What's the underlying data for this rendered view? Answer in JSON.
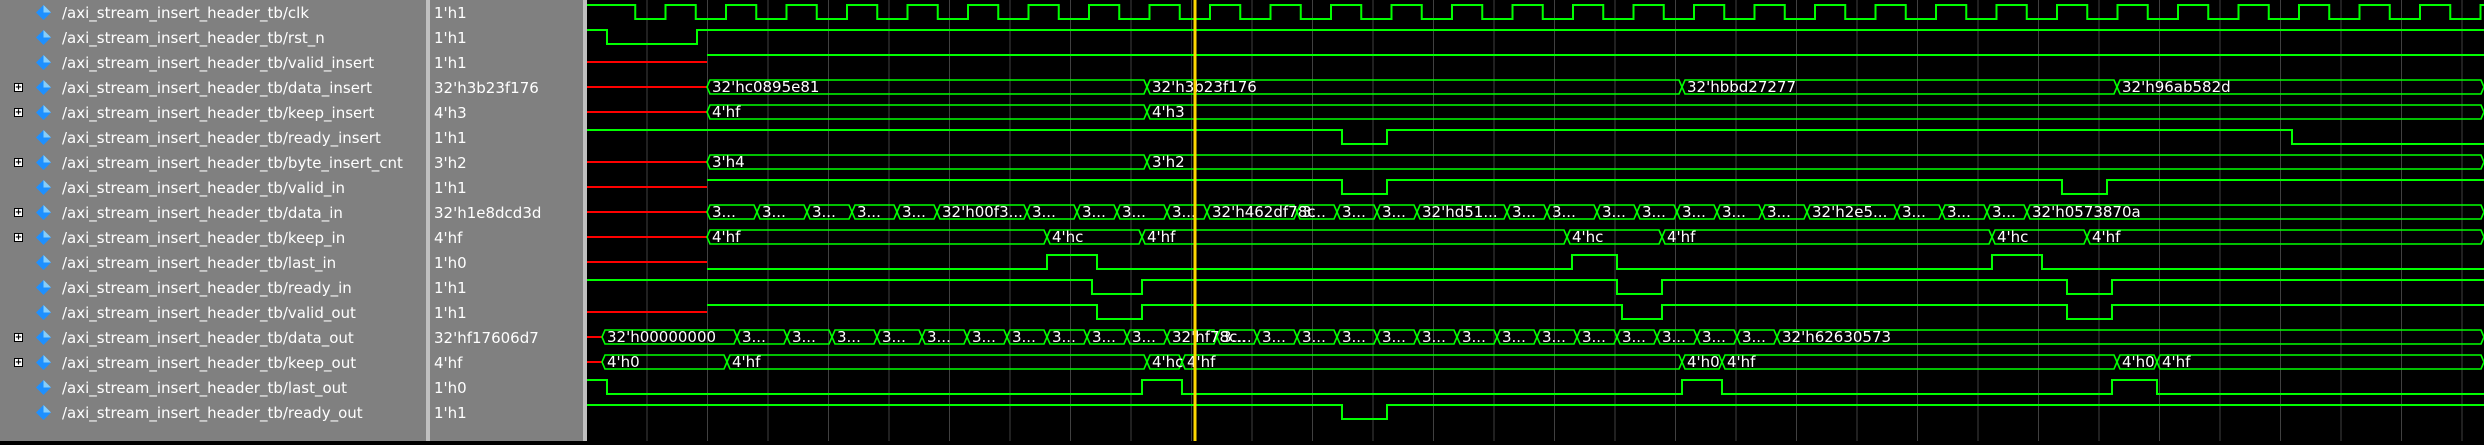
{
  "colors": {
    "signal": "#00ff00",
    "undefined": "#ff0000",
    "cursor": "#ffd700",
    "grid": "#404040",
    "panel": "#808080",
    "text": "#ffffff"
  },
  "signals": [
    {
      "name": "/axi_stream_insert_header_tb/clk",
      "value": "1'h1",
      "expandable": false,
      "icon": "signal-diamond-icon"
    },
    {
      "name": "/axi_stream_insert_header_tb/rst_n",
      "value": "1'h1",
      "expandable": false,
      "icon": "signal-diamond-icon"
    },
    {
      "name": "/axi_stream_insert_header_tb/valid_insert",
      "value": "1'h1",
      "expandable": false,
      "icon": "signal-diamond-icon"
    },
    {
      "name": "/axi_stream_insert_header_tb/data_insert",
      "value": "32'h3b23f176",
      "expandable": true,
      "icon": "signal-diamond-icon"
    },
    {
      "name": "/axi_stream_insert_header_tb/keep_insert",
      "value": "4'h3",
      "expandable": true,
      "icon": "signal-diamond-icon"
    },
    {
      "name": "/axi_stream_insert_header_tb/ready_insert",
      "value": "1'h1",
      "expandable": false,
      "icon": "signal-diamond-icon"
    },
    {
      "name": "/axi_stream_insert_header_tb/byte_insert_cnt",
      "value": "3'h2",
      "expandable": true,
      "icon": "signal-diamond-icon"
    },
    {
      "name": "/axi_stream_insert_header_tb/valid_in",
      "value": "1'h1",
      "expandable": false,
      "icon": "signal-diamond-icon"
    },
    {
      "name": "/axi_stream_insert_header_tb/data_in",
      "value": "32'h1e8dcd3d",
      "expandable": true,
      "icon": "signal-diamond-icon"
    },
    {
      "name": "/axi_stream_insert_header_tb/keep_in",
      "value": "4'hf",
      "expandable": true,
      "icon": "signal-diamond-icon"
    },
    {
      "name": "/axi_stream_insert_header_tb/last_in",
      "value": "1'h0",
      "expandable": false,
      "icon": "signal-diamond-icon"
    },
    {
      "name": "/axi_stream_insert_header_tb/ready_in",
      "value": "1'h1",
      "expandable": false,
      "icon": "signal-diamond-icon"
    },
    {
      "name": "/axi_stream_insert_header_tb/valid_out",
      "value": "1'h1",
      "expandable": false,
      "icon": "signal-diamond-icon"
    },
    {
      "name": "/axi_stream_insert_header_tb/data_out",
      "value": "32'hf17606d7",
      "expandable": true,
      "icon": "signal-diamond-icon"
    },
    {
      "name": "/axi_stream_insert_header_tb/keep_out",
      "value": "4'hf",
      "expandable": true,
      "icon": "signal-diamond-icon"
    },
    {
      "name": "/axi_stream_insert_header_tb/last_out",
      "value": "1'h0",
      "expandable": false,
      "icon": "signal-diamond-icon"
    },
    {
      "name": "/axi_stream_insert_header_tb/ready_out",
      "value": "1'h1",
      "expandable": false,
      "icon": "signal-diamond-icon"
    }
  ],
  "bus_labels": {
    "data_insert": [
      "32'hc0895e81",
      "32'h3b23f176",
      "32'hbbd27277",
      "32'h96ab582d"
    ],
    "keep_insert": [
      "4'hf",
      "4'h3"
    ],
    "byte_insert_cnt": [
      "3'h4",
      "3'h2"
    ],
    "data_in": [
      "3...",
      "3...",
      "3...",
      "3...",
      "3...",
      "32'h00f3...",
      "3...",
      "3...",
      "3...",
      "3...",
      "32'h462df78c",
      "3...",
      "3...",
      "3...",
      "32'hd51...",
      "3...",
      "3...",
      "3...",
      "3...",
      "3...",
      "3...",
      "3...",
      "32'h2e5...",
      "3...",
      "3...",
      "3...",
      "32'h0573870a"
    ],
    "keep_in": [
      "4'hf",
      "4'hc",
      "4'hf",
      "4'hc",
      "4'hf",
      "4'hc",
      "4'hf"
    ],
    "data_out": [
      "32'h00000000",
      "3...",
      "3...",
      "3...",
      "3...",
      "3...",
      "3...",
      "3...",
      "3...",
      "3...",
      "3...",
      "32'hf78c...",
      "3...",
      "3...",
      "3...",
      "3...",
      "3...",
      "3...",
      "3...",
      "3...",
      "3...",
      "3...",
      "3...",
      "3...",
      "3...",
      "3...",
      "32'h62630573"
    ],
    "keep_out": [
      "4'h0",
      "4'hf",
      "4'hc",
      "4'hf",
      "4'h0",
      "4'hf",
      "4'h0",
      "4'hf"
    ]
  }
}
